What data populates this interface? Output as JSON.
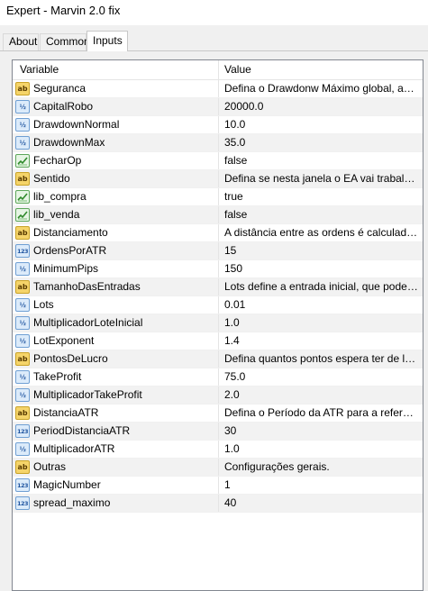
{
  "window": {
    "title": "Expert - Marvin 2.0 fix"
  },
  "tabs": [
    {
      "label": "About"
    },
    {
      "label": "Common"
    },
    {
      "label": "Inputs"
    }
  ],
  "grid": {
    "headers": {
      "variable": "Variable",
      "value": "Value"
    },
    "rows": [
      {
        "name": "Seguranca",
        "value": "Defina o Drawdonw Máximo global, após ati...",
        "icon": "ab"
      },
      {
        "name": "CapitalRobo",
        "value": "20000.0",
        "icon": "half"
      },
      {
        "name": "DrawdownNormal",
        "value": "10.0",
        "icon": "half"
      },
      {
        "name": "DrawdownMax",
        "value": "35.0",
        "icon": "half"
      },
      {
        "name": "FecharOp",
        "value": "false",
        "icon": "bool"
      },
      {
        "name": "Sentido",
        "value": "Defina se nesta janela o EA vai trabalhar co...",
        "icon": "ab"
      },
      {
        "name": "lib_compra",
        "value": "true",
        "icon": "bool"
      },
      {
        "name": "lib_venda",
        "value": "false",
        "icon": "bool"
      },
      {
        "name": "Distanciamento",
        "value": "A distância entre as ordens é calculada pela...",
        "icon": "ab"
      },
      {
        "name": "OrdensPorATR",
        "value": "15",
        "icon": "n123"
      },
      {
        "name": "MinimumPips",
        "value": "150",
        "icon": "half"
      },
      {
        "name": "TamanhoDasEntradas",
        "value": "Lots define a entrada inicial, que pode ter so...",
        "icon": "ab"
      },
      {
        "name": "Lots",
        "value": "0.01",
        "icon": "half"
      },
      {
        "name": "MultiplicadorLoteInicial",
        "value": "1.0",
        "icon": "half"
      },
      {
        "name": "LotExponent",
        "value": "1.4",
        "icon": "half"
      },
      {
        "name": "PontosDeLucro",
        "value": "Defina quantos pontos espera ter de lucro e...",
        "icon": "ab"
      },
      {
        "name": "TakeProfit",
        "value": "75.0",
        "icon": "half"
      },
      {
        "name": "MultiplicadorTakeProfit",
        "value": "2.0",
        "icon": "half"
      },
      {
        "name": "DistanciaATR",
        "value": "Defina o Período da ATR para a referência ...",
        "icon": "ab"
      },
      {
        "name": "PeriodDistanciaATR",
        "value": "30",
        "icon": "n123"
      },
      {
        "name": "MultiplicadorATR",
        "value": "1.0",
        "icon": "half"
      },
      {
        "name": "Outras",
        "value": "Configurações gerais.",
        "icon": "ab"
      },
      {
        "name": "MagicNumber",
        "value": "1",
        "icon": "n123"
      },
      {
        "name": "spread_maximo",
        "value": "40",
        "icon": "n123"
      }
    ]
  },
  "icon_glyphs": {
    "ab": "ab",
    "half": "½",
    "n123": "123"
  }
}
